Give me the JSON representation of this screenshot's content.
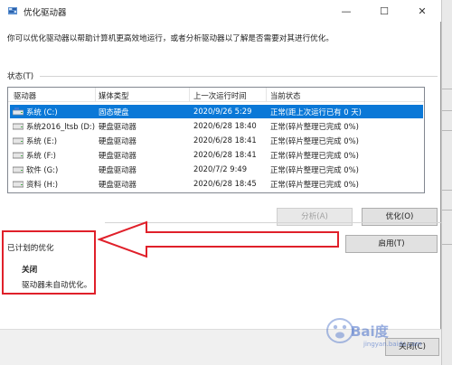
{
  "window": {
    "title": "优化驱动器",
    "controls": {
      "minimize": "—",
      "maximize": "☐",
      "close": "✕"
    },
    "icon": "defrag-app-icon"
  },
  "intro": "你可以优化驱动器以帮助计算机更高效地运行，或者分析驱动器以了解是否需要对其进行优化。",
  "status_section": {
    "label": "状态(T)"
  },
  "drive_list": {
    "columns": [
      "驱动器",
      "媒体类型",
      "上一次运行时间",
      "当前状态"
    ],
    "rows": [
      {
        "drive": "系统 (C:)",
        "media": "固态硬盘",
        "last_run": "2020/9/26 5:29",
        "status": "正常(距上次运行已有 0 天)",
        "selected": true
      },
      {
        "drive": "系统2016_ltsb (D:)",
        "media": "硬盘驱动器",
        "last_run": "2020/6/28 18:40",
        "status": "正常(碎片整理已完成 0%)",
        "selected": false
      },
      {
        "drive": "系统 (E:)",
        "media": "硬盘驱动器",
        "last_run": "2020/6/28 18:41",
        "status": "正常(碎片整理已完成 0%)",
        "selected": false
      },
      {
        "drive": "系统 (F:)",
        "media": "硬盘驱动器",
        "last_run": "2020/6/28 18:41",
        "status": "正常(碎片整理已完成 0%)",
        "selected": false
      },
      {
        "drive": "软件 (G:)",
        "media": "硬盘驱动器",
        "last_run": "2020/7/2 9:49",
        "status": "正常(碎片整理已完成 0%)",
        "selected": false
      },
      {
        "drive": "资料 (H:)",
        "media": "硬盘驱动器",
        "last_run": "2020/6/28 18:45",
        "status": "正常(碎片整理已完成 0%)",
        "selected": false
      }
    ]
  },
  "buttons": {
    "analyze": "分析(A)",
    "optimize": "优化(O)",
    "enable": "启用(T)",
    "close": "关闭(C)"
  },
  "scheduled": {
    "label": "已计划的优化",
    "status": "关闭",
    "description": "驱动器未自动优化。"
  },
  "watermark": {
    "text": "Bai度",
    "sub": "jingyan.baidu.com"
  },
  "colors": {
    "selection": "#0a78d7",
    "annotation": "#e0202a"
  }
}
